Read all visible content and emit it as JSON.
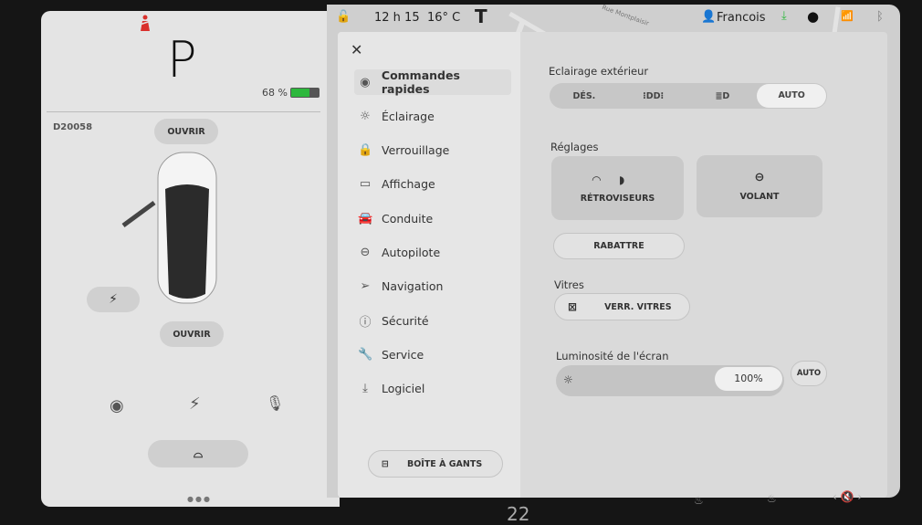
{
  "status_bar": {
    "time": "12 h 15",
    "temperature": "16° C",
    "user": "Francois",
    "map_street": "Rue Montplaisir"
  },
  "left_panel": {
    "gear": "P",
    "battery_percent": "68 %",
    "battery_level": 68,
    "battery_color": "#2db83d",
    "vehicle_id": "D20058",
    "frunk_button": "OUVRIR",
    "trunk_button": "OUVRIR",
    "seatbelt_warning_color": "#d9302c"
  },
  "menu": {
    "items": [
      {
        "label": "Commandes rapides",
        "icon": "toggle-icon",
        "active": true
      },
      {
        "label": "Éclairage",
        "icon": "sun-icon"
      },
      {
        "label": "Verrouillage",
        "icon": "lock-icon"
      },
      {
        "label": "Affichage",
        "icon": "display-icon"
      },
      {
        "label": "Conduite",
        "icon": "car-icon"
      },
      {
        "label": "Autopilote",
        "icon": "steering-wheel-icon"
      },
      {
        "label": "Navigation",
        "icon": "navigation-icon"
      },
      {
        "label": "Sécurité",
        "icon": "alert-icon"
      },
      {
        "label": "Service",
        "icon": "wrench-icon"
      },
      {
        "label": "Logiciel",
        "icon": "download-icon"
      }
    ],
    "glovebox_button": "BOÎTE À GANTS"
  },
  "content": {
    "exterior_lighting": {
      "title": "Eclairage extérieur",
      "options": [
        "DÉS.",
        "",
        "",
        "AUTO"
      ],
      "selected": "AUTO"
    },
    "settings": {
      "title": "Réglages",
      "mirrors": "RÉTROVISEURS",
      "wheel": "VOLANT",
      "fold": "RABATTRE"
    },
    "windows": {
      "title": "Vitres",
      "lock": "VERR. VITRES"
    },
    "brightness": {
      "title": "Luminosité de l'écran",
      "value": "100%",
      "level": 100,
      "auto": "AUTO"
    }
  },
  "bottom_bar": {
    "cabin_temp": "22"
  }
}
